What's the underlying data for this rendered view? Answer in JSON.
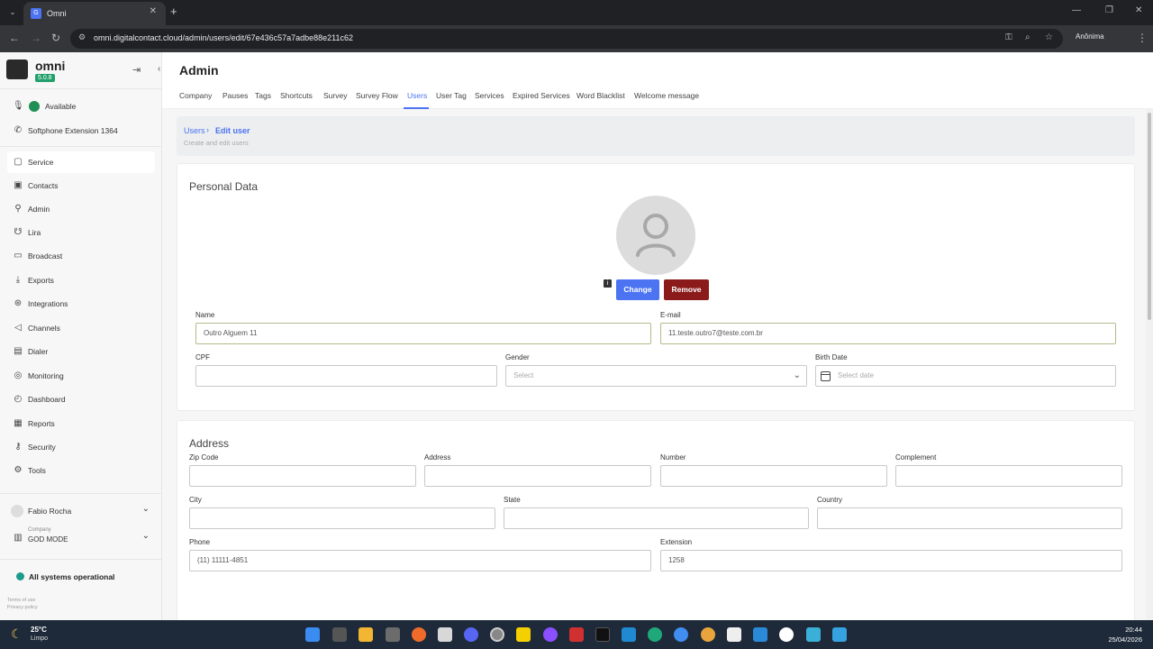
{
  "browser": {
    "tab_title": "Omni",
    "url": "omni.digitalcontact.cloud/admin/users/edit/67e436c57a7adbe88e211c62",
    "profile_label": "Anônima"
  },
  "sidebar": {
    "brand": "omni",
    "version": "5.0.8",
    "status": {
      "label": "Available",
      "color": "#1f8f55"
    },
    "softphone": "Softphone Extension 1364",
    "items": [
      {
        "label": "Service",
        "icon": "chat-icon"
      },
      {
        "label": "Contacts",
        "icon": "contacts-icon"
      },
      {
        "label": "Admin",
        "icon": "admin-icon"
      },
      {
        "label": "Lira",
        "icon": "lira-icon"
      },
      {
        "label": "Broadcast",
        "icon": "broadcast-icon"
      },
      {
        "label": "Exports",
        "icon": "export-icon"
      },
      {
        "label": "Integrations",
        "icon": "integrations-icon"
      },
      {
        "label": "Channels",
        "icon": "channels-icon"
      },
      {
        "label": "Dialer",
        "icon": "dialer-icon"
      },
      {
        "label": "Monitoring",
        "icon": "monitoring-icon"
      },
      {
        "label": "Dashboard",
        "icon": "dashboard-icon"
      },
      {
        "label": "Reports",
        "icon": "reports-icon"
      },
      {
        "label": "Security",
        "icon": "key-icon"
      },
      {
        "label": "Tools",
        "icon": "gear-icon"
      }
    ],
    "user_name": "Fabio Rocha",
    "company_label": "Company",
    "company_name": "GOD MODE",
    "system_status": "All systems operational",
    "footer_links": [
      "Terms of use",
      "Privacy policy"
    ]
  },
  "header": {
    "title": "Admin",
    "tabs": [
      "Company",
      "Pauses",
      "Tags",
      "Shortcuts",
      "Survey",
      "Survey Flow",
      "Users",
      "User Tag",
      "Services",
      "Expired Services",
      "Word Blacklist",
      "Welcome message"
    ],
    "active_tab": "Users"
  },
  "breadcrumb": {
    "parent": "Users",
    "separator": "›",
    "current": "Edit user",
    "subtitle": "Create and edit users"
  },
  "personal": {
    "title": "Personal Data",
    "change_label": "Change",
    "remove_label": "Remove",
    "name_label": "Name",
    "name_value": "Outro Alguem 11",
    "email_label": "E-mail",
    "email_value": "11.teste.outro7@teste.com.br",
    "cpf_label": "CPF",
    "cpf_value": "",
    "gender_label": "Gender",
    "gender_placeholder": "Select",
    "birth_label": "Birth Date",
    "birth_placeholder": "Select date"
  },
  "address": {
    "title": "Address",
    "zip_label": "Zip Code",
    "address_label": "Address",
    "number_label": "Number",
    "complement_label": "Complement",
    "city_label": "City",
    "state_label": "State",
    "country_label": "Country",
    "phone_label": "Phone",
    "phone_value": "(11) 11111-4851",
    "extension_label": "Extension",
    "extension_value": "1258"
  },
  "taskbar": {
    "temperature": "25°C",
    "condition": "Limpo",
    "time": "20:44",
    "date": "25/04/2026"
  },
  "colors": {
    "accent": "#4b73f2",
    "remove": "#8b1a1a",
    "available": "#1f8f55",
    "operational": "#1f9a8e"
  }
}
